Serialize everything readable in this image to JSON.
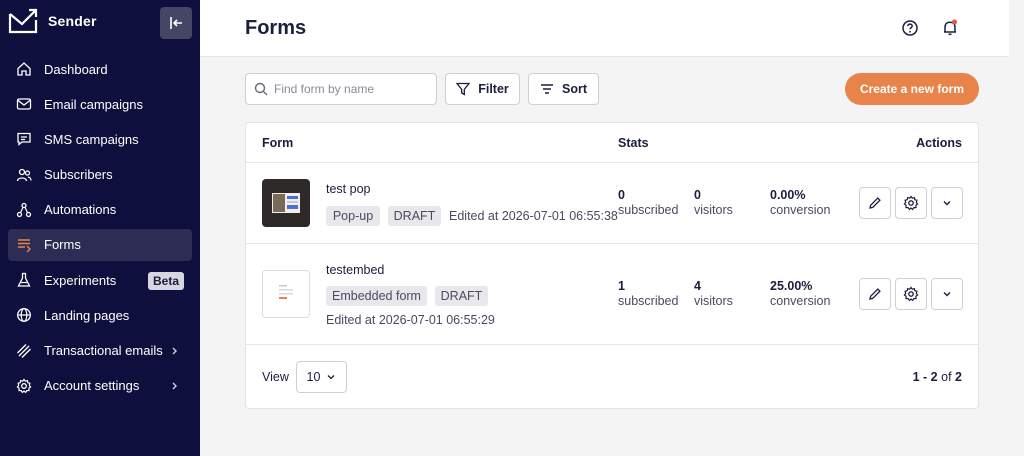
{
  "sidebar": {
    "brand": "Sender",
    "items": [
      {
        "label": "Dashboard",
        "icon": "home-icon"
      },
      {
        "label": "Email campaigns",
        "icon": "envelope-icon"
      },
      {
        "label": "SMS campaigns",
        "icon": "chat-icon"
      },
      {
        "label": "Subscribers",
        "icon": "users-icon"
      },
      {
        "label": "Automations",
        "icon": "automation-icon"
      },
      {
        "label": "Forms",
        "icon": "forms-icon",
        "active": true
      },
      {
        "label": "Experiments",
        "icon": "flask-icon",
        "badge": "Beta"
      },
      {
        "label": "Landing pages",
        "icon": "globe-icon"
      },
      {
        "label": "Transactional emails",
        "icon": "bolt-icon",
        "chevron": true
      },
      {
        "label": "Account settings",
        "icon": "gear-icon",
        "chevron": true
      }
    ]
  },
  "header": {
    "title": "Forms"
  },
  "toolbar": {
    "search_placeholder": "Find form by name",
    "filter_label": "Filter",
    "sort_label": "Sort",
    "create_label": "Create a new form"
  },
  "table": {
    "headers": {
      "form": "Form",
      "stats": "Stats",
      "actions": "Actions"
    },
    "rows": [
      {
        "name": "test pop",
        "tags": [
          "Pop-up",
          "DRAFT"
        ],
        "edited": "Edited at 2026-07-01 06:55:38",
        "subscribed": "0",
        "subscribed_label": "subscribed",
        "visitors": "0",
        "visitors_label": "visitors",
        "conversion": "0.00%",
        "conversion_label": "conversion"
      },
      {
        "name": "testembed",
        "tags": [
          "Embedded form",
          "DRAFT"
        ],
        "edited": "Edited at 2026-07-01 06:55:29",
        "subscribed": "1",
        "subscribed_label": "subscribed",
        "visitors": "4",
        "visitors_label": "visitors",
        "conversion": "25.00%",
        "conversion_label": "conversion"
      }
    ],
    "footer": {
      "view_label": "View",
      "view_value": "10",
      "range": "1 - 2",
      "of": "of",
      "total": "2"
    }
  },
  "colors": {
    "sidebar": "#0f0f3d",
    "accent": "#e8834a",
    "active_item": "#2c2c55"
  }
}
